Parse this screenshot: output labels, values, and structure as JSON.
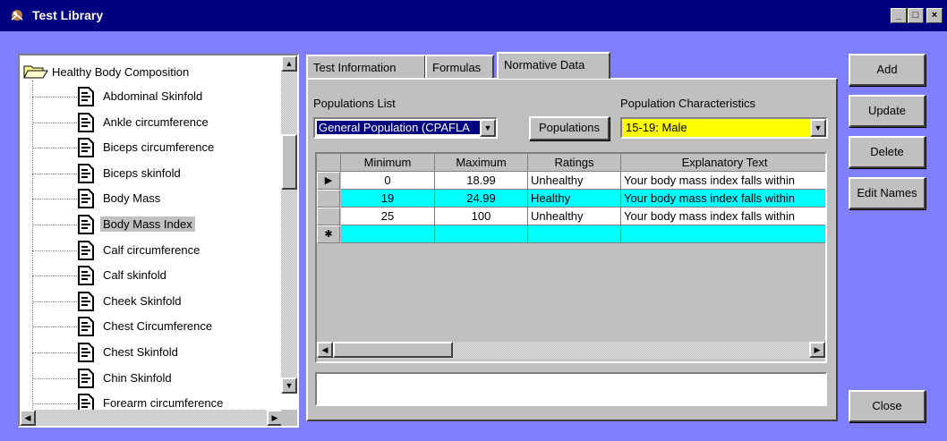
{
  "window": {
    "title": "Test Library",
    "min": "_",
    "max": "□",
    "close": "×"
  },
  "tree": {
    "root_label": "Healthy Body Composition",
    "items": [
      {
        "label": "Abdominal Skinfold",
        "selected": false
      },
      {
        "label": "Ankle circumference",
        "selected": false
      },
      {
        "label": "Biceps circumference",
        "selected": false
      },
      {
        "label": "Biceps skinfold",
        "selected": false
      },
      {
        "label": "Body Mass",
        "selected": false
      },
      {
        "label": "Body Mass Index",
        "selected": true
      },
      {
        "label": "Calf circumference",
        "selected": false
      },
      {
        "label": "Calf skinfold",
        "selected": false
      },
      {
        "label": "Cheek Skinfold",
        "selected": false
      },
      {
        "label": "Chest Circumference",
        "selected": false
      },
      {
        "label": "Chest Skinfold",
        "selected": false
      },
      {
        "label": "Chin Skinfold",
        "selected": false
      },
      {
        "label": "Forearm circumference",
        "selected": false
      }
    ]
  },
  "tabs": [
    {
      "label": "Test Information",
      "active": false
    },
    {
      "label": "Formulas",
      "active": false
    },
    {
      "label": "Normative Data",
      "active": true
    }
  ],
  "populations": {
    "list_label": "Populations List",
    "list_value": "General Population (CPAFLA",
    "button": "Populations",
    "characteristics_label": "Population Characteristics",
    "characteristics_value": "15-19: Male",
    "characteristics_bg": "#ffff00"
  },
  "grid": {
    "columns": [
      "Minimum",
      "Maximum",
      "Ratings",
      "Explanatory Text"
    ],
    "rows": [
      {
        "indicator": "▶",
        "min": "0",
        "max": "18.99",
        "rating": "Unhealthy",
        "text": "Your body mass index falls within",
        "highlight": false
      },
      {
        "indicator": "",
        "min": "19",
        "max": "24.99",
        "rating": "Healthy",
        "text": "Your body mass index falls within",
        "highlight": true
      },
      {
        "indicator": "",
        "min": "25",
        "max": "100",
        "rating": "Unhealthy",
        "text": "Your body mass index falls within",
        "highlight": false
      },
      {
        "indicator": "✱",
        "min": "",
        "max": "",
        "rating": "",
        "text": "",
        "highlight": true
      }
    ],
    "highlight_color": "#00ffff"
  },
  "explanatory_text_value": "",
  "side_buttons": [
    "Add",
    "Update",
    "Delete",
    "Edit Names"
  ],
  "close_button": "Close",
  "colors": {
    "titlebar": "#000080",
    "desktop": "#8080ff",
    "face": "#c0c0c0"
  }
}
